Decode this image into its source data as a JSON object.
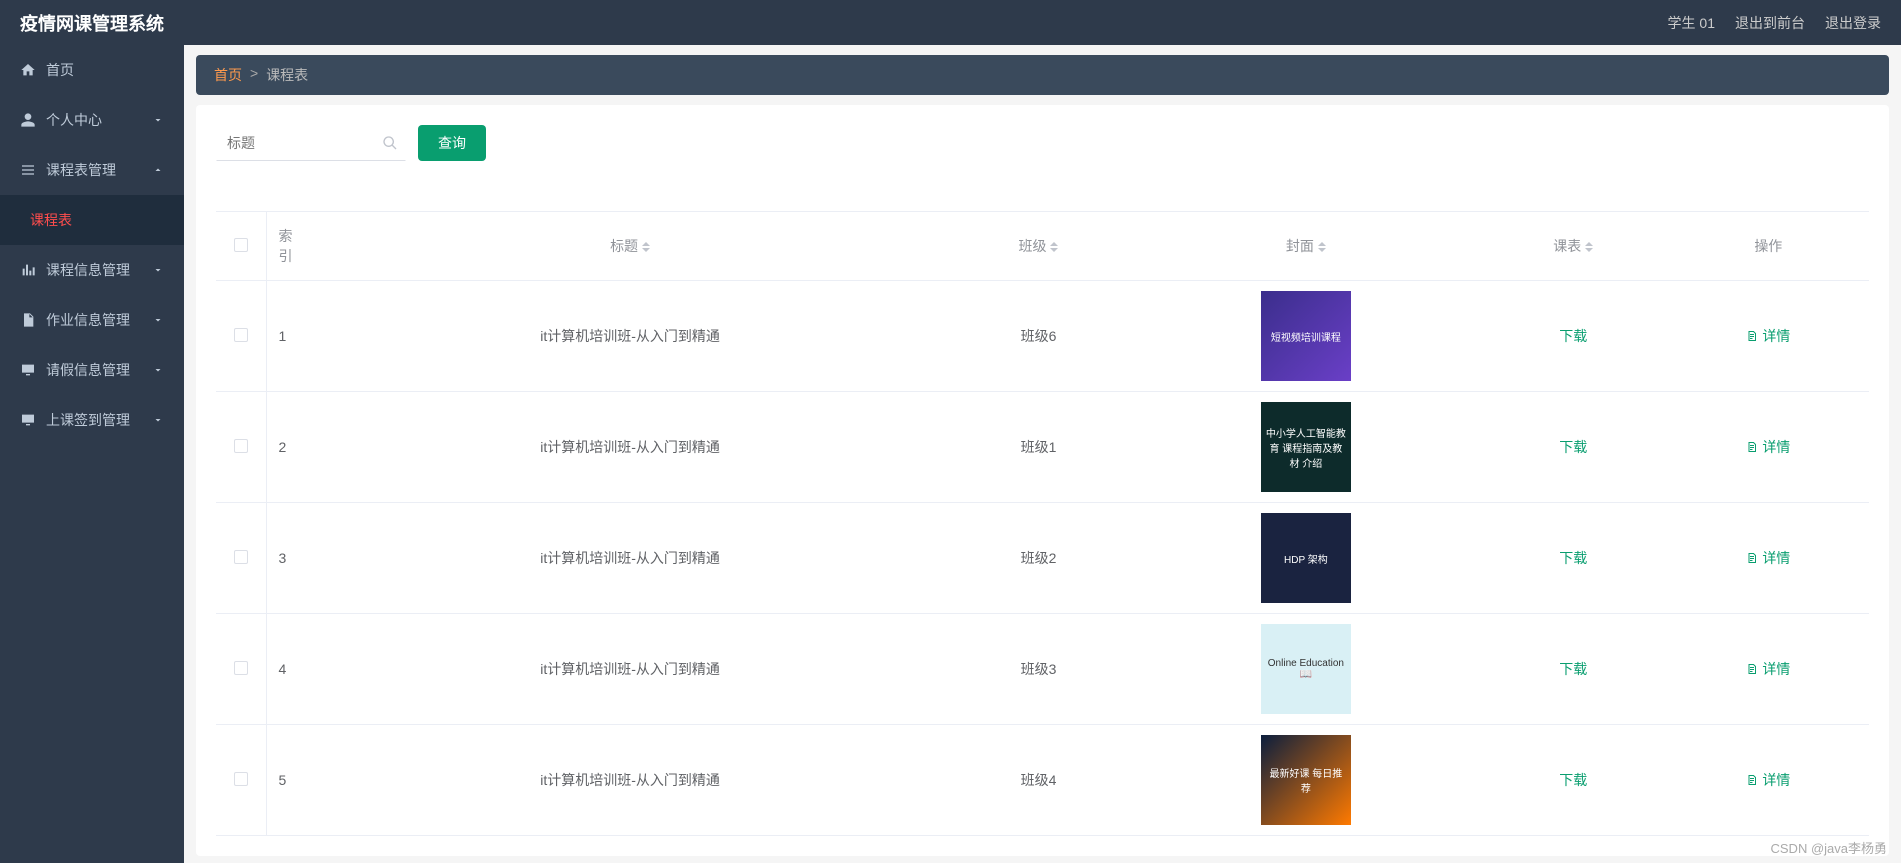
{
  "header": {
    "title": "疫情网课管理系统",
    "user": "学生 01",
    "back_front": "退出到前台",
    "logout": "退出登录"
  },
  "sidebar": {
    "home": "首页",
    "personal": "个人中心",
    "schedule_mgmt": "课程表管理",
    "schedule": "课程表",
    "course_info": "课程信息管理",
    "homework": "作业信息管理",
    "leave": "请假信息管理",
    "checkin": "上课签到管理"
  },
  "breadcrumb": {
    "home": "首页",
    "current": "课程表"
  },
  "filter": {
    "placeholder": "标题",
    "search_btn": "查询"
  },
  "table": {
    "headers": {
      "index": "索引",
      "title": "标题",
      "class": "班级",
      "cover": "封面",
      "timetable": "课表",
      "action": "操作"
    },
    "download": "下载",
    "detail": "详情",
    "rows": [
      {
        "idx": "1",
        "title": "it计算机培训班-从入门到精通",
        "class": "班级6",
        "cover_text": "短视频培训课程",
        "cover_bg": "linear-gradient(135deg,#3b2e8c,#6a3fc7)"
      },
      {
        "idx": "2",
        "title": "it计算机培训班-从入门到精通",
        "class": "班级1",
        "cover_text": "中小学人工智能教育 课程指南及教材 介绍",
        "cover_bg": "#0d2b2b"
      },
      {
        "idx": "3",
        "title": "it计算机培训班-从入门到精通",
        "class": "班级2",
        "cover_text": "HDP 架构",
        "cover_bg": "#1a2340"
      },
      {
        "idx": "4",
        "title": "it计算机培训班-从入门到精通",
        "class": "班级3",
        "cover_text": "Online Education 📖",
        "cover_bg": "#d9f0f5"
      },
      {
        "idx": "5",
        "title": "it计算机培训班-从入门到精通",
        "class": "班级4",
        "cover_text": "最新好课 每日推荐",
        "cover_bg": "linear-gradient(135deg,#0b1e3d,#ff7a00)"
      }
    ]
  },
  "watermark": "CSDN @java李杨勇"
}
